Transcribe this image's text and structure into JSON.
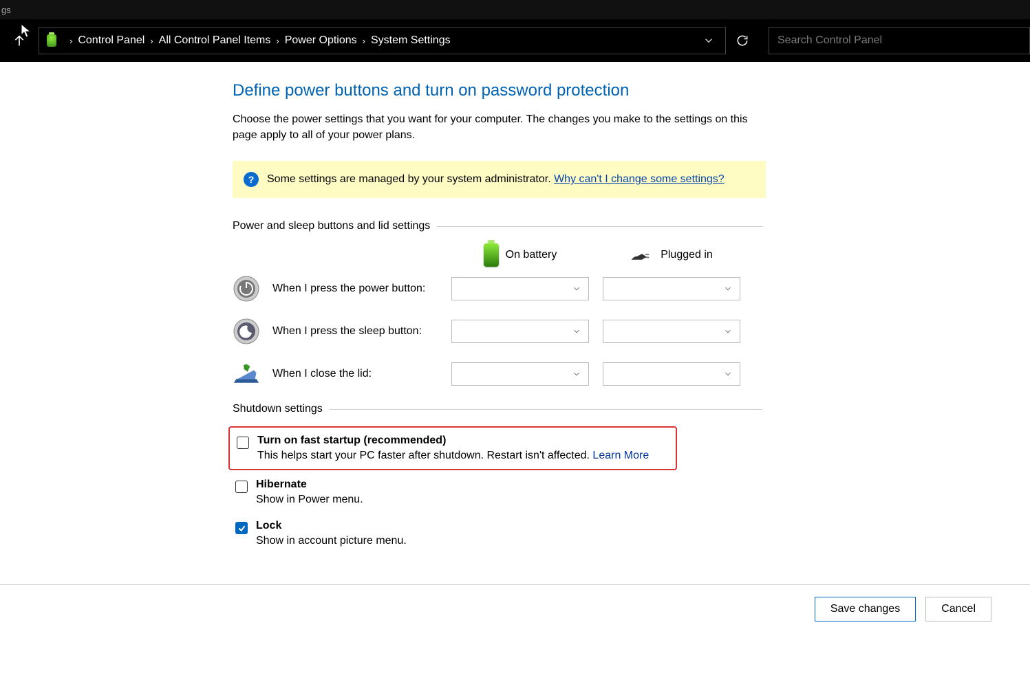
{
  "titlebar": {
    "text": "gs"
  },
  "breadcrumb": {
    "items": [
      "Control Panel",
      "All Control Panel Items",
      "Power Options",
      "System Settings"
    ]
  },
  "search": {
    "placeholder": "Search Control Panel"
  },
  "page": {
    "title": "Define power buttons and turn on password protection",
    "description": "Choose the power settings that you want for your computer. The changes you make to the settings on this page apply to all of your power plans."
  },
  "banner": {
    "text": "Some settings are managed by your system administrator. ",
    "link": "Why can't I change some settings?"
  },
  "section1": {
    "legend": "Power and sleep buttons and lid settings",
    "col_battery": "On battery",
    "col_plugged": "Plugged in",
    "rows": [
      {
        "label": "When I press the power button:"
      },
      {
        "label": "When I press the sleep button:"
      },
      {
        "label": "When I close the lid:"
      }
    ]
  },
  "section2": {
    "legend": "Shutdown settings",
    "items": [
      {
        "title": "Turn on fast startup (recommended)",
        "desc": "This helps start your PC faster after shutdown. Restart isn't affected. ",
        "link": "Learn More",
        "checked": false,
        "highlighted": true
      },
      {
        "title": "Hibernate",
        "desc": "Show in Power menu.",
        "link": "",
        "checked": false,
        "highlighted": false
      },
      {
        "title": "Lock",
        "desc": "Show in account picture menu.",
        "link": "",
        "checked": true,
        "highlighted": false
      }
    ]
  },
  "footer": {
    "save": "Save changes",
    "cancel": "Cancel"
  }
}
